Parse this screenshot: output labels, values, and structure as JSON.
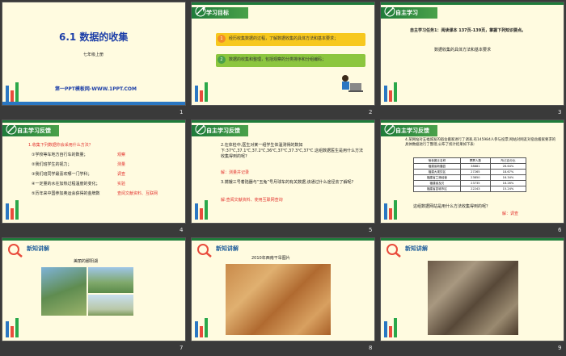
{
  "slides": [
    {
      "num": "1",
      "title": "6.1 数据的收集",
      "subtitle": "七年级上册",
      "footer": "第一PPT模板网-WWW.1PPT.COM"
    },
    {
      "num": "2",
      "header": "学习目标",
      "goals": [
        "经历收集数据的过程，了解数据收集的具体方法和基本要求；",
        "数据的收集和整理，包括观察的分类排序和分组编码；"
      ],
      "goal_nums": [
        "1",
        "2"
      ]
    },
    {
      "num": "3",
      "header": "自主学习",
      "task": "自主学习任务1：阅读课本 137页-139页，掌握下列知识要点。",
      "point": "数据收集的具体方法和基本要求"
    },
    {
      "num": "4",
      "header": "自主学习反馈",
      "q": "1.收集下列数据你会采用什么方法？",
      "items": [
        {
          "q": "①学校等车地方自行车的数量；",
          "a": "观察"
        },
        {
          "q": "②我们班学生的视力；",
          "a": "测量"
        },
        {
          "q": "③我们班同学最喜欢哪一门学科；",
          "a": "调查"
        },
        {
          "q": "④一定量的水在加热过程温度的变化；",
          "a": "实验"
        },
        {
          "q": "⑤历年来中国参加奥运会获得的金牌数",
          "a": "查阅文献资料、互联网"
        }
      ]
    },
    {
      "num": "5",
      "header": "自主学习反馈",
      "q2": "2.在体检中,医生对某一组学生体温测得的数如下:37℃,37.1℃,37.2℃,36℃,37℃,37.3℃,37℃.这组数据医生是用什么方法收集得到的呢?",
      "a2": "解：测量并记录",
      "q3": "3.嫦娥三号着陆器与“玉兔”号月球车的有关数据,该通过什么途径去了解呢?",
      "a3": "解:查阅文献资料、使用互联网查询"
    },
    {
      "num": "6",
      "header": "自主学习反馈",
      "q": "4.某网站对五福城发的宿舍搬家进行了调查,有145984人参与投票.网站对网友对宿舍搬家要求的具体数据进行了整理,公布了统计结果如下表:",
      "table_head": [
        "宿舍搬迁名称",
        "票票人数",
        "所占百分比"
      ],
      "table_rows": [
        [
          "福建省新疆县",
          "38881",
          "26.64%"
        ],
        [
          "福建大观饮区",
          "27265",
          "18.67%"
        ],
        [
          "福建省兰港经营",
          "23850",
          "16.34%"
        ],
        [
          "福建省及贝",
          "23735",
          "16.26%"
        ],
        [
          "福建省县城市区",
          "22243",
          "15.24%"
        ]
      ],
      "ask": "这组数据网站是用什么方法收集得到的呢？",
      "answer": "解：调查"
    },
    {
      "num": "7",
      "header": "新知讲解",
      "caption": "美丽的鄱阳湖"
    },
    {
      "num": "8",
      "header": "新知讲解",
      "caption": "2010年西南干旱图片"
    },
    {
      "num": "9",
      "header": "新知讲解"
    }
  ]
}
